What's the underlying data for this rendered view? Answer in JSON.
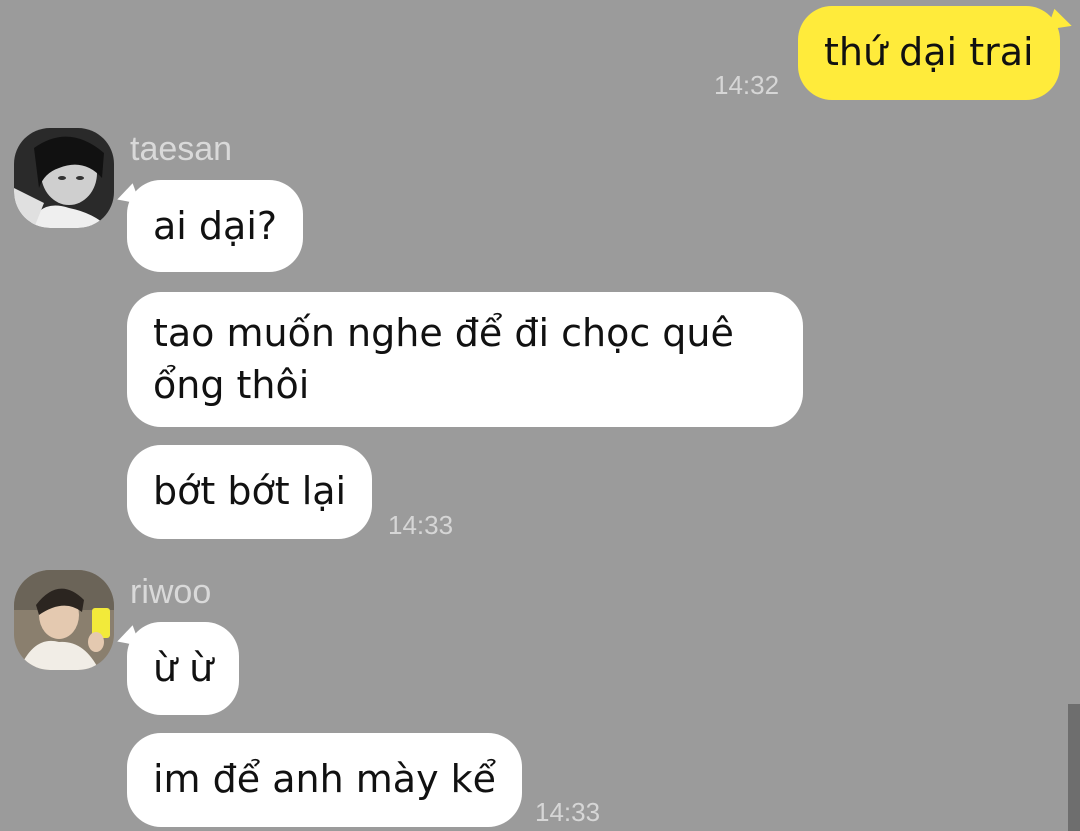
{
  "outgoing": {
    "text": "thứ dại trai",
    "time": "14:32"
  },
  "groups": [
    {
      "sender": "taesan",
      "avatar_icon": "avatar-photo-taesan",
      "messages": [
        "ai dại?",
        "tao muốn nghe để đi chọc quê ổng thôi",
        "bớt bớt lại"
      ],
      "time": "14:33"
    },
    {
      "sender": "riwoo",
      "avatar_icon": "avatar-photo-riwoo",
      "messages": [
        "ừ ừ",
        "im để anh mày kể"
      ],
      "time": "14:33"
    }
  ],
  "colors": {
    "background": "#9b9b9b",
    "outgoing_bubble": "#ffeb3b",
    "incoming_bubble": "#ffffff"
  }
}
